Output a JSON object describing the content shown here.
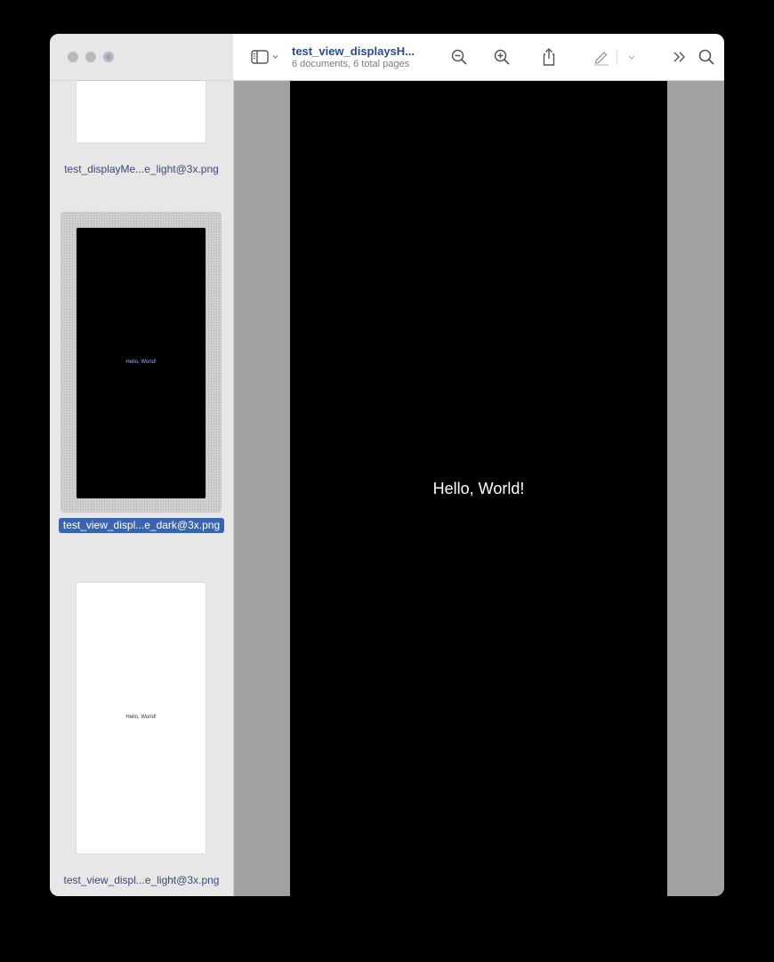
{
  "toolbar": {
    "title": "test_view_displaysH...",
    "subtitle": "6 documents, 6 total pages",
    "icons": [
      "sidebar-toggle-icon",
      "zoom-out-icon",
      "zoom-in-icon",
      "share-icon",
      "markup-pen-icon",
      "more-chevrons-icon",
      "search-icon"
    ]
  },
  "sidebar": {
    "items": [
      {
        "label": "test_displayMe...e_light@3x.png",
        "theme": "light",
        "preview_text": "",
        "selected": false
      },
      {
        "label": "test_view_displ...e_dark@3x.png",
        "theme": "dark",
        "preview_text": "Hello, World!",
        "selected": true
      },
      {
        "label": "test_view_displ...e_light@3x.png",
        "theme": "light",
        "preview_text": "Hello, World!",
        "selected": false
      }
    ]
  },
  "main": {
    "page_text": "Hello, World!",
    "page_background": "#000000",
    "canvas_background": "#a1a1a1"
  },
  "colors": {
    "accent": "#3a64ad",
    "title": "#2c4a8c"
  }
}
